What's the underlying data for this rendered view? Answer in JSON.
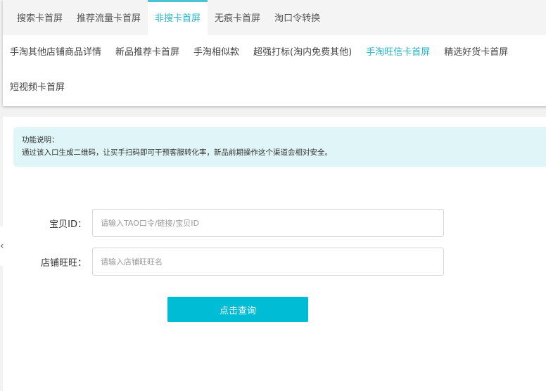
{
  "tabs": [
    "搜索卡首屏",
    "推荐流量卡首屏",
    "非搜卡首屏",
    "无痕卡首屏",
    "淘口令转换"
  ],
  "subtabs": [
    "手淘其他店铺商品详情",
    "新品推荐卡首屏",
    "手淘相似款",
    "超强打标(淘内免费其他)",
    "手淘旺信卡首屏",
    "精选好货卡首屏",
    "短视频卡首屏"
  ],
  "notice": {
    "title": "功能说明：",
    "text": "通过该入口生成二维码，让买手扫码即可干预客服转化率，新品前期操作这个渠道会相对安全。"
  },
  "form": {
    "item_label": "宝贝ID：",
    "item_placeholder": "请输入TAO口令/链接/宝贝ID",
    "shop_label": "店铺旺旺：",
    "shop_placeholder": "请输入店铺旺旺名",
    "submit": "点击查询"
  },
  "side_icon": "‹"
}
